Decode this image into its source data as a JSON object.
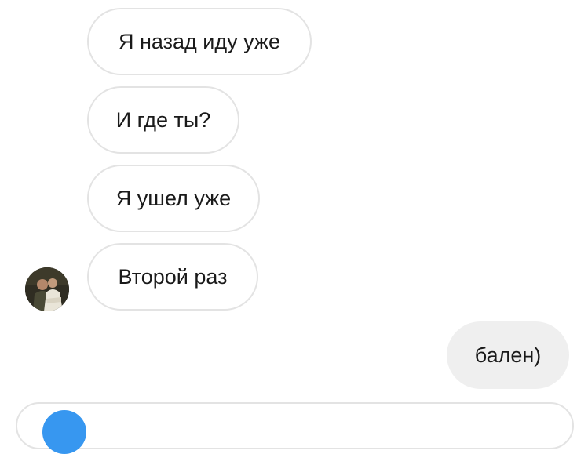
{
  "messages": [
    {
      "direction": "incoming",
      "text": "Я назад иду уже"
    },
    {
      "direction": "incoming",
      "text": "И где ты?"
    },
    {
      "direction": "incoming",
      "text": "Я ушел уже"
    },
    {
      "direction": "incoming",
      "text": "Второй раз"
    },
    {
      "direction": "outgoing",
      "text": "бален)"
    }
  ],
  "avatar": {
    "icon": "contact-avatar-photo"
  },
  "composer": {
    "icon": "camera-icon",
    "accent_color": "#3797f0"
  },
  "colors": {
    "incoming_border": "#e3e3e3",
    "outgoing_background": "#efefef",
    "text": "#1a1a1a"
  }
}
